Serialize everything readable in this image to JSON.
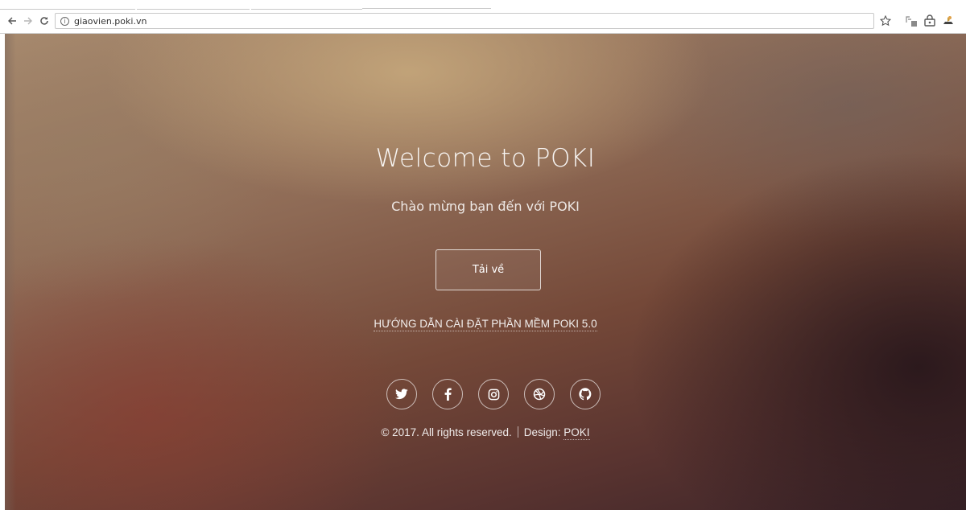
{
  "browser": {
    "url": "giaovien.poki.vn",
    "icons": [
      "back-arrow-icon",
      "forward-arrow-icon",
      "reload-icon",
      "info-icon",
      "star-icon",
      "extension-icons"
    ]
  },
  "page": {
    "title": "Welcome to POKI",
    "subtitle": "Chào mừng bạn đến với POKI",
    "download_label": "Tải về",
    "guide_link": "HƯỚNG DẪN CÀI ĐẶT PHẦN MỀM POKI 5.0",
    "socials": [
      "twitter",
      "facebook",
      "instagram",
      "dribbble",
      "github"
    ],
    "footer": {
      "copyright": "© 2017. All rights reserved.",
      "design_prefix": "Design:",
      "design_name": "POKI"
    }
  },
  "colors": {
    "text": "#ffffff",
    "bg_top": "#a88a6e",
    "bg_bottom": "#3a2328"
  }
}
